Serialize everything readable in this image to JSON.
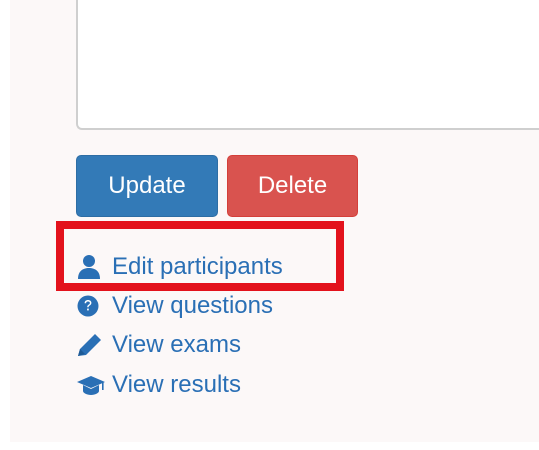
{
  "form": {
    "textarea_value": ""
  },
  "buttons": {
    "update_label": "Update",
    "delete_label": "Delete"
  },
  "links": [
    {
      "label": "Edit participants",
      "icon": "user-icon"
    },
    {
      "label": "View questions",
      "icon": "question-circle-icon"
    },
    {
      "label": "View exams",
      "icon": "pencil-icon"
    },
    {
      "label": "View results",
      "icon": "graduation-cap-icon"
    }
  ],
  "colors": {
    "primary": "#337ab7",
    "danger": "#d9534f",
    "link": "#2a6fb5",
    "highlight": "#e3121c",
    "panel_bg": "#fcf8f8"
  }
}
